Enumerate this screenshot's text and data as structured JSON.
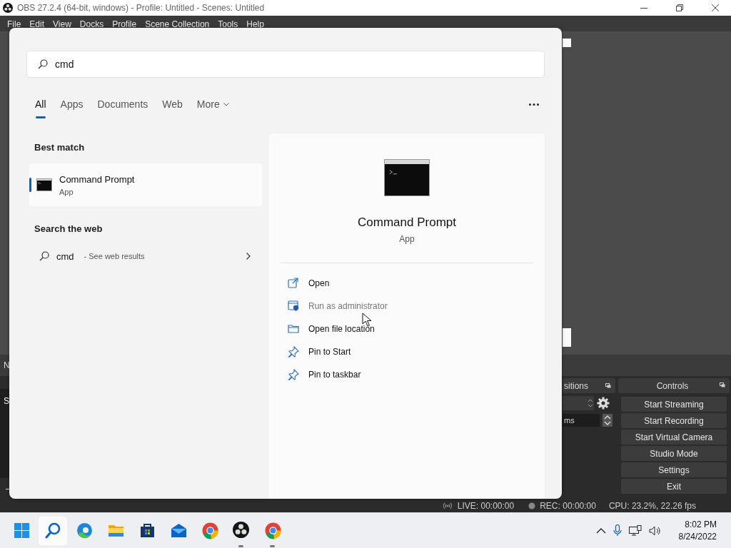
{
  "window": {
    "title": "OBS 27.2.4 (64-bit, windows) - Profile: Untitled - Scenes: Untitled"
  },
  "menu": [
    "File",
    "Edit",
    "View",
    "Docks",
    "Profile",
    "Scene Collection",
    "Tools",
    "Help"
  ],
  "context_bar": {
    "text": "N"
  },
  "scenes": {
    "items": [
      "S"
    ]
  },
  "transitions": {
    "title": "sitions",
    "duration": "ms"
  },
  "controls": {
    "title": "Controls",
    "buttons": [
      "Start Streaming",
      "Start Recording",
      "Start Virtual Camera",
      "Studio Mode",
      "Settings",
      "Exit"
    ]
  },
  "status_bar": {
    "live": "LIVE: 00:00:00",
    "rec": "REC: 00:00:00",
    "cpu": "CPU: 23.2%, 22.26 fps"
  },
  "search": {
    "query": "cmd",
    "tabs": [
      {
        "label": "All",
        "selected": true,
        "dropdown": false
      },
      {
        "label": "Apps",
        "selected": false,
        "dropdown": false
      },
      {
        "label": "Documents",
        "selected": false,
        "dropdown": false
      },
      {
        "label": "Web",
        "selected": false,
        "dropdown": false
      },
      {
        "label": "More",
        "selected": false,
        "dropdown": true
      }
    ],
    "best_match_heading": "Best match",
    "best_match": {
      "name": "Command Prompt",
      "type": "App",
      "selected": true
    },
    "web_heading": "Search the web",
    "web_result": {
      "query": "cmd",
      "hint": "- See web results"
    },
    "preview": {
      "name": "Command Prompt",
      "type": "App",
      "actions": [
        {
          "kind": "open",
          "label": "Open",
          "disabled": false
        },
        {
          "kind": "admin",
          "label": "Run as administrator",
          "disabled": true
        },
        {
          "kind": "folder",
          "label": "Open file location",
          "disabled": false
        },
        {
          "kind": "pin",
          "label": "Pin to Start",
          "disabled": false
        },
        {
          "kind": "pin",
          "label": "Pin to taskbar",
          "disabled": false
        }
      ]
    }
  },
  "taskbar": {
    "apps": [
      {
        "kind": "start",
        "selected": false,
        "running": false
      },
      {
        "kind": "search",
        "selected": true,
        "running": false
      },
      {
        "kind": "edge",
        "selected": false,
        "running": false
      },
      {
        "kind": "explorer",
        "selected": false,
        "running": false
      },
      {
        "kind": "store",
        "selected": false,
        "running": false
      },
      {
        "kind": "mail",
        "selected": false,
        "running": false
      },
      {
        "kind": "chrome",
        "selected": false,
        "running": false
      },
      {
        "kind": "obs",
        "selected": false,
        "running": true
      },
      {
        "kind": "chrome",
        "selected": false,
        "running": true
      }
    ],
    "clock": {
      "time": "8:02 PM",
      "date": "8/24/2022"
    }
  }
}
